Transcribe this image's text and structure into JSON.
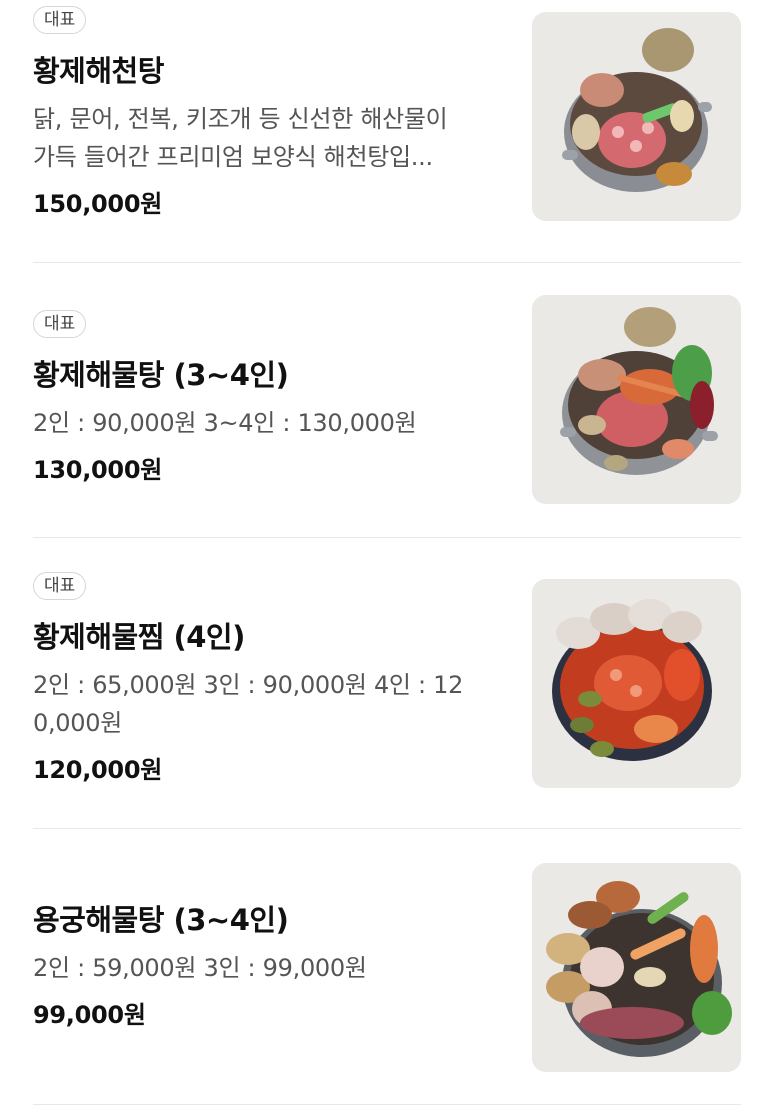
{
  "menu": {
    "items": [
      {
        "badge": "대표",
        "name": "황제해천탕",
        "desc_lines": [
          "닭, 문어, 전복, 키조개 등 신선한 해산물이",
          "가득 들어간 프리미엄 보양식 해천탕입..."
        ],
        "price": "150,000원",
        "image_icon": "seafood-hotpot-photo"
      },
      {
        "badge": "대표",
        "name": "황제해물탕 (3~4인)",
        "desc_lines": [
          "2인 : 90,000원 3~4인 : 130,000원"
        ],
        "price": "130,000원",
        "image_icon": "seafood-stew-photo"
      },
      {
        "badge": "대표",
        "name": "황제해물찜 (4인)",
        "desc_lines": [
          "2인 : 65,000원 3인 : 90,000원 4인 : 12",
          "0,000원"
        ],
        "price": "120,000원",
        "image_icon": "braised-seafood-photo"
      },
      {
        "badge": "",
        "name": "용궁해물탕 (3~4인)",
        "desc_lines": [
          "2인 : 59,000원 3인 : 99,000원"
        ],
        "price": "99,000원",
        "image_icon": "dragon-palace-seafood-photo"
      }
    ]
  },
  "colors": {
    "title": "#111111",
    "description": "#555555",
    "badge_border": "#d6d6d6",
    "divider": "#e8e8e8"
  }
}
